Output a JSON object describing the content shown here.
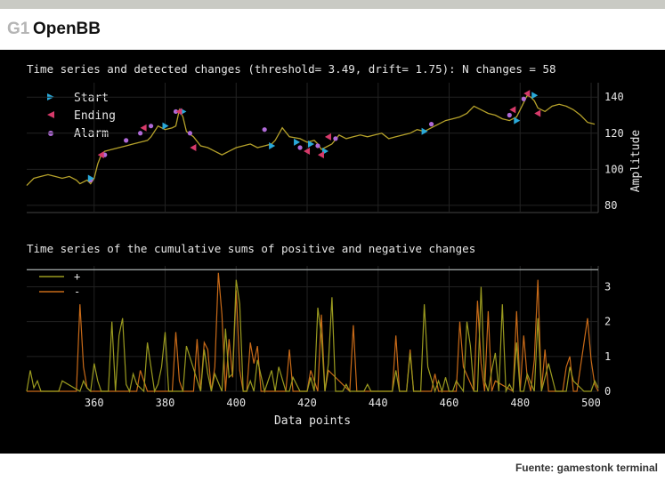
{
  "header": {
    "tag": "G1",
    "title": "OpenBB"
  },
  "footer": {
    "source": "Fuente: gamestonk terminal"
  },
  "chart_data": [
    {
      "type": "line",
      "title": "Time series and detected changes (threshold= 3.49, drift= 1.75): N changes = 58",
      "ylabel": "Amplitude",
      "xlim": [
        341,
        502
      ],
      "ylim": [
        76,
        148
      ],
      "yticks": [
        80,
        100,
        120,
        140
      ],
      "grid": true,
      "legend": {
        "placement": "top-left",
        "entries": [
          "Start",
          "Ending",
          "Alarm"
        ]
      },
      "colors": {
        "line": "#b5a12a",
        "start": "#2aa9d9",
        "ending": "#d63a6a",
        "alarm": "#b06ad8"
      },
      "series": [
        {
          "name": "Amplitude",
          "x": [
            341,
            343,
            345,
            347,
            349,
            351,
            353,
            355,
            356,
            358,
            359,
            360,
            361,
            362,
            363,
            365,
            367,
            369,
            371,
            373,
            375,
            376,
            378,
            380,
            382,
            383,
            384,
            385,
            386,
            388,
            390,
            392,
            394,
            396,
            398,
            400,
            402,
            404,
            406,
            408,
            410,
            411,
            413,
            415,
            418,
            420,
            422,
            423,
            424,
            425,
            426,
            427,
            429,
            431,
            433,
            435,
            437,
            439,
            441,
            443,
            445,
            447,
            449,
            451,
            453,
            455,
            457,
            459,
            461,
            463,
            465,
            467,
            469,
            471,
            473,
            475,
            477,
            479,
            481,
            482,
            483,
            484,
            485,
            487,
            489,
            491,
            493,
            495,
            497,
            499,
            501
          ],
          "y": [
            91,
            95,
            96,
            97,
            96,
            95,
            96,
            94,
            92,
            94,
            92,
            95,
            103,
            108,
            110,
            111,
            112,
            113,
            114,
            115,
            116,
            118,
            124,
            122,
            123,
            124,
            133,
            129,
            121,
            118,
            113,
            112,
            110,
            108,
            110,
            112,
            113,
            114,
            112,
            113,
            114,
            116,
            123,
            118,
            117,
            115,
            116,
            114,
            111,
            112,
            113,
            114,
            119,
            117,
            118,
            119,
            118,
            119,
            120,
            117,
            118,
            119,
            120,
            122,
            121,
            123,
            125,
            127,
            128,
            129,
            131,
            135,
            133,
            131,
            130,
            128,
            127,
            129,
            137,
            141,
            140,
            138,
            134,
            132,
            135,
            136,
            135,
            133,
            130,
            126,
            125
          ]
        }
      ],
      "markers": {
        "start": {
          "x": [
            359,
            380,
            385,
            410,
            417,
            421,
            425,
            453,
            479,
            484
          ],
          "y": [
            95,
            124,
            132,
            113,
            115,
            114,
            110,
            121,
            127,
            141
          ]
        },
        "ending": {
          "x": [
            362,
            374,
            384,
            388,
            420,
            424,
            426,
            478,
            482,
            485
          ],
          "y": [
            108,
            123,
            132,
            112,
            110,
            108,
            118,
            133,
            142,
            131
          ]
        },
        "alarm": {
          "x": [
            359,
            363,
            369,
            373,
            376,
            383,
            387,
            408,
            418,
            423,
            428,
            455,
            477,
            481
          ],
          "y": [
            94,
            108,
            116,
            120,
            124,
            132,
            120,
            122,
            112,
            113,
            117,
            125,
            130,
            139
          ]
        }
      }
    },
    {
      "type": "line",
      "title": "Time series of the cumulative sums of positive and negative changes",
      "xlabel": "Data points",
      "xlim": [
        341,
        502
      ],
      "xticks": [
        360,
        380,
        400,
        420,
        440,
        460,
        480,
        500
      ],
      "ylim": [
        0,
        3.6
      ],
      "yticks": [
        0,
        1,
        2,
        3
      ],
      "threshold": 3.49,
      "grid": true,
      "legend": {
        "placement": "top-left",
        "entries": [
          "+",
          "-"
        ]
      },
      "colors": {
        "plus": "#9a9a1f",
        "minus": "#c86a18",
        "threshold": "#9aa0a0"
      },
      "series": [
        {
          "name": "+",
          "x": [
            341,
            342,
            343,
            344,
            345,
            350,
            351,
            356,
            357,
            358,
            359,
            360,
            361,
            362,
            364,
            365,
            366,
            367,
            368,
            369,
            370,
            371,
            372,
            374,
            375,
            377,
            378,
            379,
            380,
            381,
            385,
            386,
            390,
            391,
            392,
            393,
            394,
            396,
            397,
            398,
            399,
            400,
            401,
            402,
            403,
            404,
            405,
            406,
            408,
            410,
            411,
            412,
            414,
            415,
            416,
            418,
            420,
            421,
            422,
            423,
            424,
            425,
            426,
            427,
            428,
            430,
            431,
            432,
            436,
            437,
            438,
            444,
            445,
            446,
            448,
            449,
            450,
            452,
            453,
            454,
            456,
            457,
            458,
            459,
            460,
            461,
            462,
            464,
            465,
            466,
            467,
            468,
            469,
            470,
            471,
            472,
            473,
            474,
            475,
            476,
            477,
            478,
            479,
            480,
            481,
            482,
            484,
            485,
            486,
            488,
            490,
            492,
            493,
            494,
            495,
            498,
            499,
            500,
            501,
            502
          ],
          "y": [
            0,
            0.6,
            0.1,
            0.3,
            0,
            0,
            0.3,
            0,
            0.3,
            0.1,
            0,
            0.8,
            0.3,
            0,
            0,
            2.0,
            0,
            1.6,
            2.1,
            0.2,
            0,
            0.5,
            0.2,
            0,
            1.4,
            0,
            0.2,
            0.7,
            1.7,
            0,
            0,
            1.3,
            0,
            1.2,
            0.5,
            0,
            0.5,
            0,
            1.8,
            0.4,
            0.5,
            3.2,
            2.5,
            0,
            0,
            0.3,
            0,
            0.9,
            0,
            0.6,
            0,
            0.7,
            0,
            0,
            0.4,
            0,
            0,
            0.4,
            0,
            2.4,
            1.6,
            0,
            0.8,
            2.7,
            0,
            0,
            0.2,
            0,
            0,
            0.2,
            0,
            0,
            0.6,
            0,
            0,
            1.1,
            0,
            0,
            2.5,
            0.7,
            0,
            0.3,
            0,
            0.4,
            0,
            0,
            0.3,
            0,
            2.0,
            1.3,
            0,
            0,
            3.0,
            0.3,
            0,
            0.6,
            1.1,
            0,
            2.5,
            0,
            0.2,
            0,
            1.4,
            0,
            0,
            0.5,
            0,
            2.1,
            0,
            0.8,
            0,
            0,
            0,
            0.7,
            0.3,
            0,
            0,
            0,
            0.3,
            0.1
          ]
        },
        {
          "name": "-",
          "x": [
            341,
            355,
            356,
            357,
            358,
            359,
            372,
            373,
            375,
            377,
            382,
            383,
            384,
            385,
            388,
            389,
            390,
            391,
            392,
            393,
            394,
            395,
            396,
            397,
            398,
            399,
            400,
            401,
            402,
            403,
            404,
            405,
            406,
            407,
            408,
            414,
            415,
            416,
            418,
            420,
            421,
            423,
            424,
            425,
            426,
            432,
            433,
            434,
            444,
            445,
            446,
            448,
            449,
            450,
            455,
            456,
            457,
            462,
            463,
            464,
            467,
            468,
            469,
            470,
            471,
            472,
            473,
            478,
            479,
            480,
            481,
            482,
            483,
            484,
            485,
            486,
            487,
            488,
            492,
            493,
            494,
            495,
            496,
            499,
            500,
            501,
            502
          ],
          "y": [
            0,
            0,
            2.5,
            0.7,
            0.1,
            0,
            0,
            0.6,
            0,
            0,
            0,
            1.7,
            0.3,
            0,
            0,
            1.5,
            0,
            1.4,
            1.2,
            0,
            0.7,
            3.4,
            2.2,
            0,
            1.5,
            0.4,
            2.9,
            0.6,
            0,
            0,
            1.4,
            0.8,
            1.3,
            0,
            0,
            0,
            1.2,
            0,
            0,
            0,
            0.6,
            0,
            2.2,
            0,
            0.6,
            0,
            1.9,
            0,
            0,
            1.6,
            0,
            0,
            1.2,
            0,
            0,
            0.5,
            0,
            0,
            2.0,
            0.7,
            0,
            2.6,
            0.8,
            0,
            2.3,
            0,
            0.3,
            0,
            2.3,
            0,
            1.6,
            0.4,
            0,
            0.9,
            3.2,
            0,
            1.2,
            0,
            0,
            0.7,
            1.0,
            0,
            0,
            2.1,
            0.9,
            0.2,
            0
          ]
        }
      ]
    }
  ]
}
